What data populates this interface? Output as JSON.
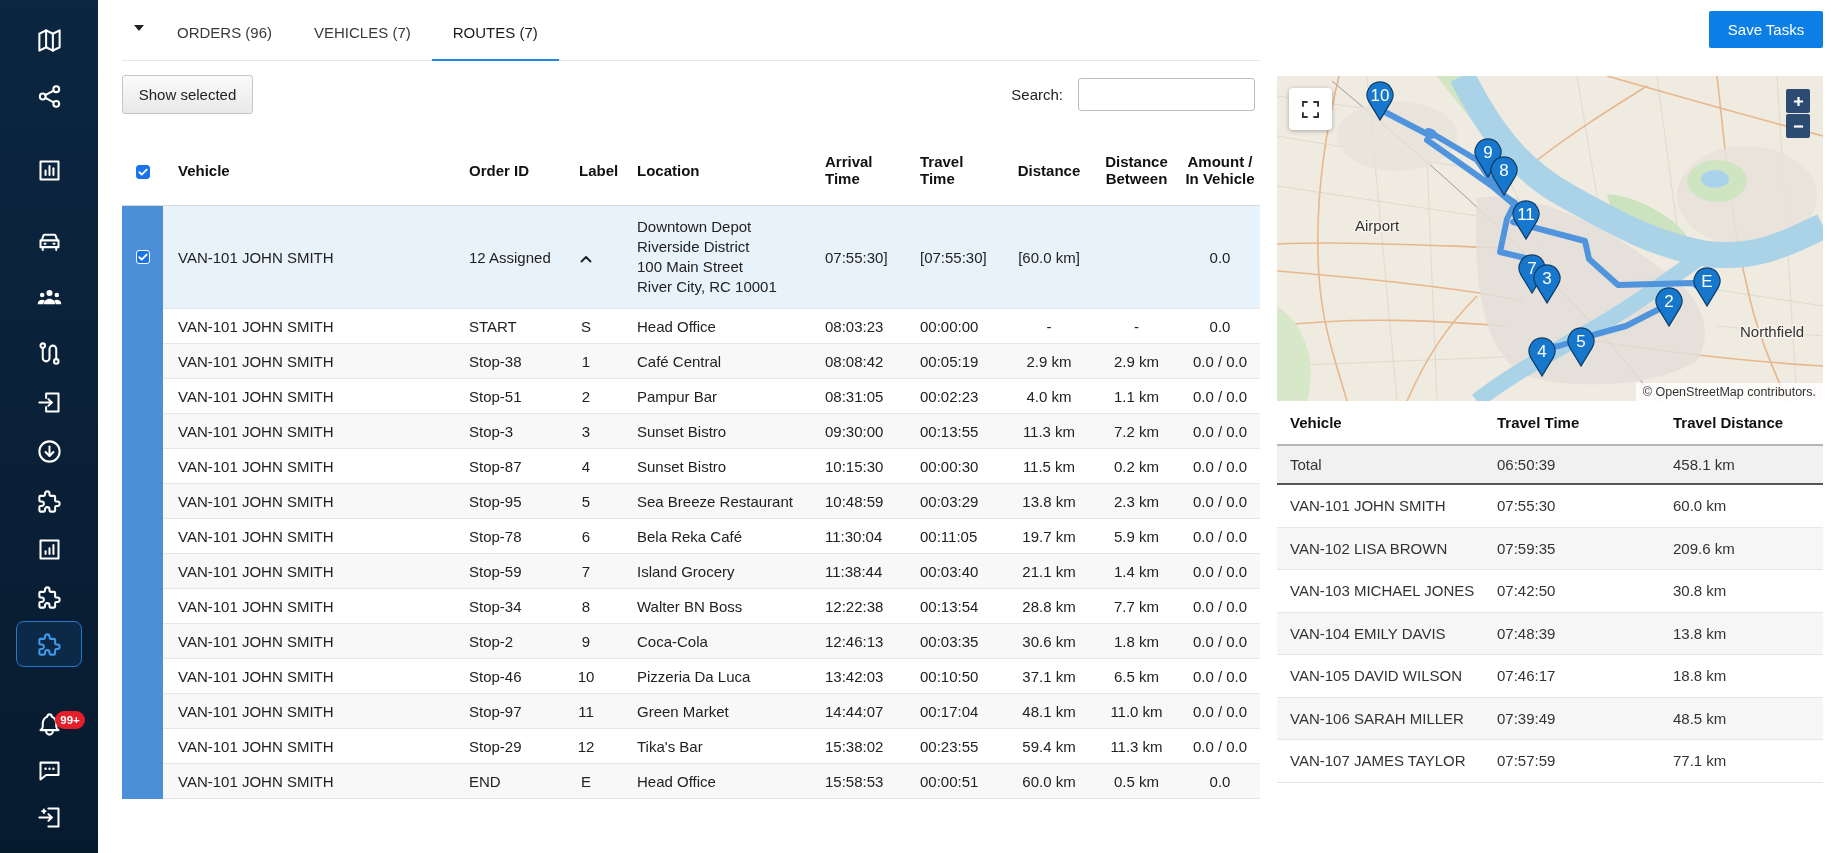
{
  "sidebar": {
    "items": [
      {
        "selected": false
      },
      {
        "selected": false
      },
      {
        "selected": false
      },
      {
        "selected": false
      },
      {
        "selected": false
      },
      {
        "selected": false
      },
      {
        "selected": false
      },
      {
        "selected": false
      },
      {
        "selected": false
      },
      {
        "selected": false
      },
      {
        "selected": false
      },
      {
        "selected": true
      },
      {
        "selected": false,
        "badge": "99+"
      },
      {
        "selected": false
      },
      {
        "selected": false
      }
    ]
  },
  "tabs": [
    {
      "label": "ORDERS (96)",
      "selected": false
    },
    {
      "label": "VEHICLES (7)",
      "selected": false
    },
    {
      "label": "ROUTES (7)",
      "selected": true
    }
  ],
  "save_button": "Save Tasks",
  "toolbar": {
    "show_selected_button": "Show selected",
    "search_label": "Search:"
  },
  "table": {
    "select_all_checked": true,
    "columns": [
      "Vehicle",
      "Order ID",
      "Label",
      "Location",
      "Arrival Time",
      "Travel Time",
      "Distance",
      "Distance Between",
      "Amount / In Vehicle"
    ],
    "group": {
      "checked": true,
      "expanded": true,
      "vehicle": "VAN-101 JOHN SMITH",
      "order_id": "12 Assigned",
      "location": [
        "Downtown Depot",
        "Riverside District",
        "100 Main Street",
        "River City, RC 10001"
      ],
      "arrival_time": "07:55:30]",
      "travel_time": "[07:55:30]",
      "distance": "[60.0 km]",
      "amount": "0.0"
    },
    "rows": [
      [
        "VAN-101 JOHN SMITH",
        "START",
        "S",
        "Head Office",
        "08:03:23",
        "00:00:00",
        "-",
        "-",
        "0.0"
      ],
      [
        "VAN-101 JOHN SMITH",
        "Stop-38",
        "1",
        "Café Central",
        "08:08:42",
        "00:05:19",
        "2.9 km",
        "2.9 km",
        "0.0 / 0.0"
      ],
      [
        "VAN-101 JOHN SMITH",
        "Stop-51",
        "2",
        "Pampur Bar",
        "08:31:05",
        "00:02:23",
        "4.0 km",
        "1.1 km",
        "0.0 / 0.0"
      ],
      [
        "VAN-101 JOHN SMITH",
        "Stop-3",
        "3",
        "Sunset Bistro",
        "09:30:00",
        "00:13:55",
        "11.3 km",
        "7.2 km",
        "0.0 / 0.0"
      ],
      [
        "VAN-101 JOHN SMITH",
        "Stop-87",
        "4",
        "Sunset Bistro",
        "10:15:30",
        "00:00:30",
        "11.5 km",
        "0.2 km",
        "0.0 / 0.0"
      ],
      [
        "VAN-101 JOHN SMITH",
        "Stop-95",
        "5",
        "Sea Breeze Restaurant",
        "10:48:59",
        "00:03:29",
        "13.8 km",
        "2.3 km",
        "0.0 / 0.0"
      ],
      [
        "VAN-101 JOHN SMITH",
        "Stop-78",
        "6",
        "Bela Reka Café",
        "11:30:04",
        "00:11:05",
        "19.7 km",
        "5.9 km",
        "0.0 / 0.0"
      ],
      [
        "VAN-101 JOHN SMITH",
        "Stop-59",
        "7",
        "Island Grocery",
        "11:38:44",
        "00:03:40",
        "21.1 km",
        "1.4 km",
        "0.0 / 0.0"
      ],
      [
        "VAN-101 JOHN SMITH",
        "Stop-34",
        "8",
        "Walter BN Boss",
        "12:22:38",
        "00:13:54",
        "28.8 km",
        "7.7 km",
        "0.0 / 0.0"
      ],
      [
        "VAN-101 JOHN SMITH",
        "Stop-2",
        "9",
        "Coca-Cola",
        "12:46:13",
        "00:03:35",
        "30.6 km",
        "1.8 km",
        "0.0 / 0.0"
      ],
      [
        "VAN-101 JOHN SMITH",
        "Stop-46",
        "10",
        "Pizzeria Da Luca",
        "13:42:03",
        "00:10:50",
        "37.1 km",
        "6.5 km",
        "0.0 / 0.0"
      ],
      [
        "VAN-101 JOHN SMITH",
        "Stop-97",
        "11",
        "Green Market",
        "14:44:07",
        "00:17:04",
        "48.1 km",
        "11.0 km",
        "0.0 / 0.0"
      ],
      [
        "VAN-101 JOHN SMITH",
        "Stop-29",
        "12",
        "Tika's Bar",
        "15:38:02",
        "00:23:55",
        "59.4 km",
        "11.3 km",
        "0.0 / 0.0"
      ],
      [
        "VAN-101 JOHN SMITH",
        "END",
        "E",
        "Head Office",
        "15:58:53",
        "00:00:51",
        "60.0 km",
        "0.5 km",
        "0.0"
      ]
    ]
  },
  "map": {
    "markers": [
      {
        "label": "10"
      },
      {
        "label": "9"
      },
      {
        "label": "8"
      },
      {
        "label": "11"
      },
      {
        "label": "7"
      },
      {
        "label": "3"
      },
      {
        "label": "E"
      },
      {
        "label": "2"
      },
      {
        "label": "5"
      },
      {
        "label": "4"
      }
    ],
    "place_labels": [
      "Airport",
      "Northfield"
    ],
    "attribution": "© OpenStreetMap contributors."
  },
  "summary": {
    "columns": [
      "Vehicle",
      "Travel Time",
      "Travel Distance"
    ],
    "total": [
      "Total",
      "06:50:39",
      "458.1 km"
    ],
    "rows": [
      [
        "VAN-101 JOHN SMITH",
        "07:55:30",
        "60.0 km"
      ],
      [
        "VAN-102 LISA BROWN",
        "07:59:35",
        "209.6 km"
      ],
      [
        "VAN-103 MICHAEL JONES",
        "07:42:50",
        "30.8 km"
      ],
      [
        "VAN-104 EMILY DAVIS",
        "07:48:39",
        "13.8 km"
      ],
      [
        "VAN-105 DAVID WILSON",
        "07:46:17",
        "18.8 km"
      ],
      [
        "VAN-106 SARAH MILLER",
        "07:39:49",
        "48.5 km"
      ],
      [
        "VAN-107 JAMES TAYLOR",
        "07:57:59",
        "77.1 km"
      ]
    ]
  }
}
